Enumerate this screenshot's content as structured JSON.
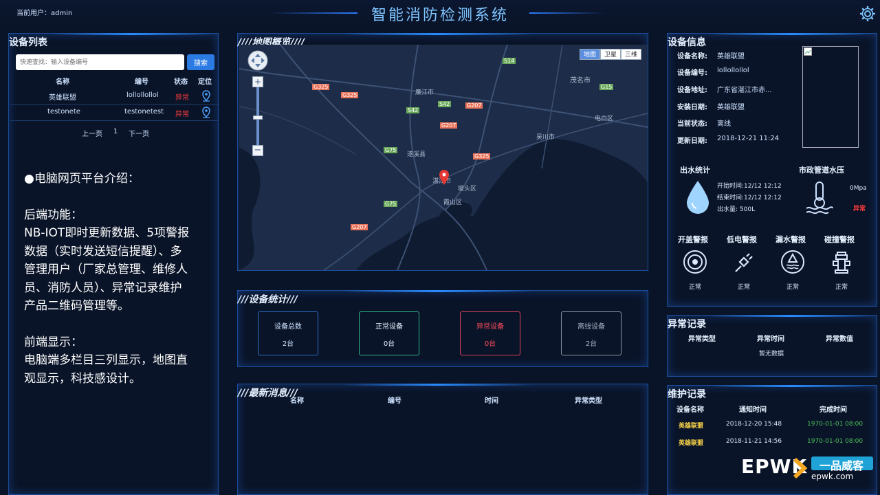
{
  "header": {
    "current_user": "当前用户：admin",
    "title": "智能消防检测系统"
  },
  "device_list": {
    "title": "设备列表",
    "search_placeholder": "快速查找：输入设备编号",
    "search_button": "搜索",
    "columns": [
      "名称",
      "编号",
      "状态",
      "定位"
    ],
    "rows": [
      {
        "name": "英雄联盟",
        "code": "lollollollol",
        "status": "异常"
      },
      {
        "name": "testonete",
        "code": "testonetest",
        "status": "异常"
      }
    ],
    "pager": {
      "prev": "上一页",
      "page": "1",
      "next": "下一页"
    }
  },
  "intro": {
    "title": "●电脑网页平台介绍：",
    "backend_title": "后端功能：",
    "backend_text": "NB-IOT即时更新数据、5项警报数据（实时发送短信提醒）、多管理用户（厂家总管理、维修人员、消防人员）、异常记录维护产品二维码管理等。",
    "frontend_title": "前端显示：",
    "frontend_text": "电脑端多栏目三列显示，地图直观显示，科技感设计。"
  },
  "map": {
    "title": "////地图概览////",
    "tabs": [
      "地图",
      "卫星",
      "三维"
    ],
    "road_labels": [
      "S14",
      "G325",
      "G325",
      "G15",
      "S42",
      "S42",
      "G207",
      "G207",
      "G75",
      "G325",
      "G75",
      "G207"
    ],
    "cities": [
      "廉江市",
      "茂名市",
      "电白区",
      "吴川市",
      "遂溪县",
      "湛江市",
      "坡头区",
      "霞山区"
    ]
  },
  "stats": {
    "title": "///设备统计///",
    "boxes": [
      {
        "label": "设备总数",
        "value": "2台"
      },
      {
        "label": "正常设备",
        "value": "0台"
      },
      {
        "label": "异常设备",
        "value": "0台"
      },
      {
        "label": "离线设备",
        "value": "2台"
      }
    ]
  },
  "messages": {
    "title": "///最新消息///",
    "columns": [
      "名称",
      "编号",
      "时间",
      "异常类型"
    ]
  },
  "device_info": {
    "title": "设备信息",
    "fields": [
      {
        "label": "设备名称:",
        "value": "英雄联盟"
      },
      {
        "label": "设备编号:",
        "value": "lollollollol"
      },
      {
        "label": "设备地址:",
        "value": "广东省湛江市赤..."
      },
      {
        "label": "安装日期:",
        "value": "英雄联盟"
      },
      {
        "label": "当前状态:",
        "value": "离线"
      },
      {
        "label": "更新日期:",
        "value": "2018-12-21 11:24"
      }
    ],
    "water_stats": {
      "title": "出水统计",
      "start": "开始时间:12/12 12:12",
      "end": "结束时间:12/12 12:12",
      "amount": "出水量:  500L"
    },
    "pressure": {
      "title": "市政管道水压",
      "value": "0Mpa",
      "status": "异常"
    },
    "alarms": [
      {
        "label": "开盖警报",
        "status": "正常",
        "icon": "target-icon"
      },
      {
        "label": "低电警报",
        "status": "正常",
        "icon": "plug-icon"
      },
      {
        "label": "漏水警报",
        "status": "正常",
        "icon": "water-level-icon"
      },
      {
        "label": "碰撞警报",
        "status": "正常",
        "icon": "hydrant-icon"
      }
    ]
  },
  "abnormal": {
    "title": "异常记录",
    "columns": [
      "异常类型",
      "异常时间",
      "异常数值"
    ],
    "empty": "暂无数据"
  },
  "maintenance": {
    "title": "维护记录",
    "columns": [
      "设备名称",
      "通知时间",
      "完成时间"
    ],
    "rows": [
      {
        "name": "英雄联盟",
        "notify": "2018-12-20 15:48",
        "done": "1970-01-01 08:00"
      },
      {
        "name": "英雄联盟",
        "notify": "2018-11-21 14:56",
        "done": "1970-01-01 08:00"
      }
    ]
  },
  "watermark": {
    "brand": "EPWK",
    "cn": "一品威客",
    "url": "epwk.com"
  },
  "colors": {
    "accent": "#2c7be5",
    "alert": "#ff3b3b",
    "normal_box": "#2fb38a",
    "alert_box": "#d9435b",
    "offline_box": "#8a97a8"
  }
}
